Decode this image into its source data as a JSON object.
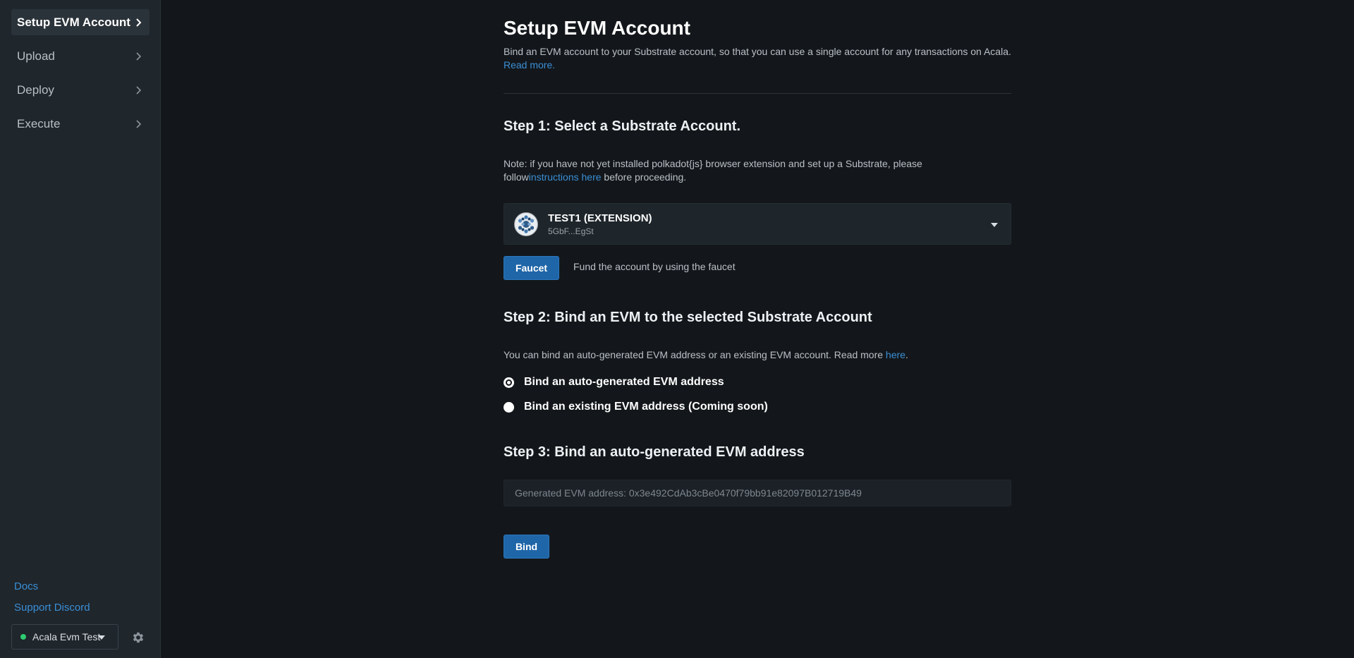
{
  "sidebar": {
    "items": [
      {
        "label": "Setup EVM Account",
        "active": true
      },
      {
        "label": "Upload"
      },
      {
        "label": "Deploy"
      },
      {
        "label": "Execute"
      }
    ],
    "links": {
      "docs": "Docs",
      "discord": "Support Discord"
    },
    "network": {
      "label": "Acala Evm Test",
      "status_color": "#2ecc71"
    }
  },
  "page": {
    "title": "Setup EVM Account",
    "intro": "Bind an EVM account to your Substrate account, so that you can use a single account for any transactions on Acala.",
    "intro_link": "Read more."
  },
  "step1": {
    "heading": "Step 1: Select a Substrate Account.",
    "note_prefix": "Note: if you have not yet installed polkadot{js} browser extension and set up a Substrate, please follow",
    "note_link": "instructions here",
    "note_suffix": " before proceeding.",
    "account": {
      "name": "TEST1 (EXTENSION)",
      "address": "5GbF...EgSt"
    },
    "faucet_button": "Faucet",
    "faucet_desc": "Fund the account by using the faucet"
  },
  "step2": {
    "heading": "Step 2: Bind an EVM to the selected Substrate Account",
    "note_prefix": "You can bind an auto-generated EVM address or an existing EVM account. Read more ",
    "note_link": "here",
    "note_suffix": ".",
    "options": [
      {
        "label": "Bind an auto-generated EVM address",
        "checked": true
      },
      {
        "label": "Bind an existing EVM address (Coming soon)",
        "checked": false
      }
    ]
  },
  "step3": {
    "heading": "Step 3: Bind an auto-generated EVM address",
    "generated_address": "Generated EVM address: 0x3e492CdAb3cBe0470f79bb91e82097B012719B49",
    "bind_button": "Bind"
  },
  "colors": {
    "accent": "#1f66a8",
    "link": "#3a8fd6",
    "background": "#13171b",
    "sidebar": "#1f262c"
  }
}
